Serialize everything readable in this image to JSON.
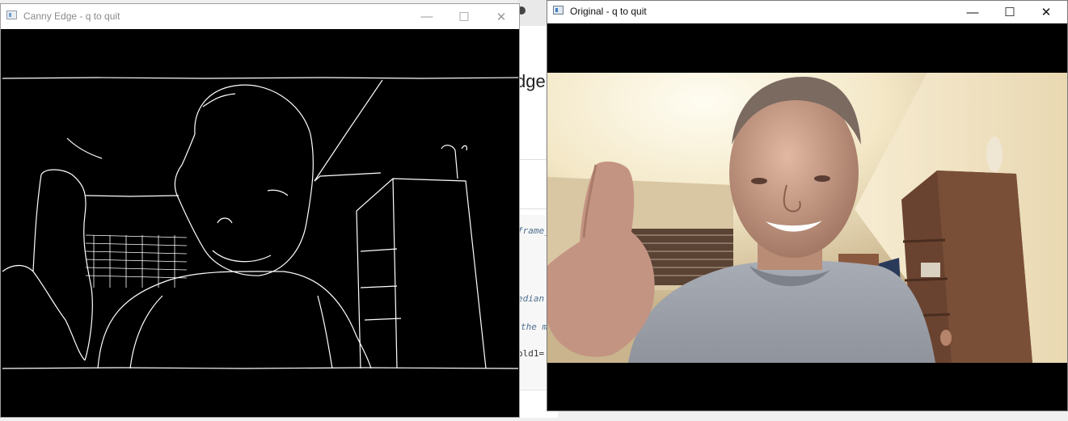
{
  "background_editor": {
    "heading_fragment": "dge",
    "code_fragments": [
      "frame_",
      "edian",
      "the m",
      "old1="
    ]
  },
  "canny_window": {
    "title": "Canny Edge - q to quit",
    "minimize_glyph": "—",
    "maximize_glyph": "☐",
    "close_glyph": "✕"
  },
  "original_window": {
    "title": "Original - q to quit",
    "minimize_glyph": "—",
    "maximize_glyph": "☐",
    "close_glyph": "✕"
  }
}
